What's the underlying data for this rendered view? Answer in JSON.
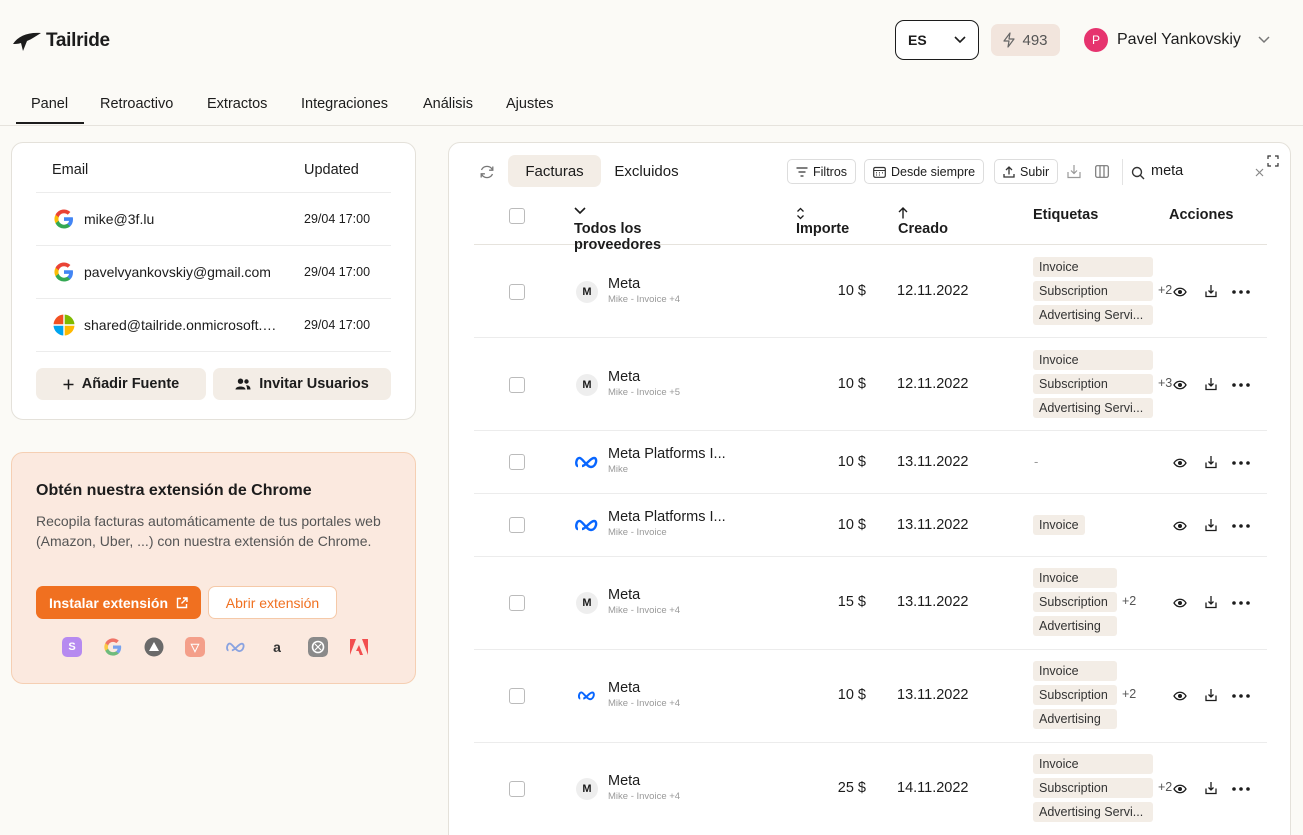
{
  "app": {
    "name": "Tailride"
  },
  "header": {
    "language": "ES",
    "credits": "493",
    "user_initial": "P",
    "user_name": "Pavel Yankovskiy"
  },
  "nav": {
    "tabs": [
      "Panel",
      "Retroactivo",
      "Extractos",
      "Integraciones",
      "Análisis",
      "Ajustes"
    ],
    "active": "Panel"
  },
  "sources": {
    "col_email": "Email",
    "col_updated": "Updated",
    "rows": [
      {
        "provider": "google",
        "email": "mike@3f.lu",
        "updated": "29/04 17:00"
      },
      {
        "provider": "google",
        "email": "pavelvyankovskiy@gmail.com",
        "updated": "29/04 17:00"
      },
      {
        "provider": "microsoft",
        "email": "shared@tailride.onmicrosoft.com",
        "updated": "29/04 17:00"
      }
    ],
    "add_source": "Añadir Fuente",
    "invite_users": "Invitar Usuarios"
  },
  "extension": {
    "title": "Obtén nuestra extensión de Chrome",
    "description": "Recopila facturas automáticamente de tus portales web (Amazon, Uber, ...) con nuestra extensión de Chrome.",
    "install_label": "Instalar extensión",
    "open_label": "Abrir extensión",
    "icons": [
      "stripe-icon",
      "google-icon",
      "arc-icon",
      "shop-icon",
      "meta-icon",
      "amazon-icon",
      "openai-icon",
      "adobe-icon"
    ]
  },
  "invoices": {
    "tabs": [
      "Facturas",
      "Excluidos"
    ],
    "active_tab": "Facturas",
    "toolbar": {
      "filters": "Filtros",
      "range": "Desde siempre",
      "upload": "Subir",
      "search_value": "meta"
    },
    "columns": {
      "vendor": "Todos los proveedores",
      "amount": "Importe",
      "created": "Creado",
      "tags": "Etiquetas",
      "actions": "Acciones"
    },
    "rows": [
      {
        "logo": "M",
        "name": "Meta",
        "sub": "Mike - Invoice +4",
        "amount": "10 $",
        "date": "12.11.2022",
        "tags": [
          "Invoice",
          "Subscription",
          "Advertising Servi..."
        ],
        "more": "+2"
      },
      {
        "logo": "M",
        "name": "Meta",
        "sub": "Mike - Invoice +5",
        "amount": "10 $",
        "date": "12.11.2022",
        "tags": [
          "Invoice",
          "Subscription",
          "Advertising Servi..."
        ],
        "more": "+3"
      },
      {
        "logo": "meta",
        "name": "Meta Platforms I...",
        "sub": "Mike",
        "amount": "10 $",
        "date": "13.11.2022",
        "tags": [],
        "more": "",
        "empty": "-"
      },
      {
        "logo": "meta",
        "name": "Meta Platforms I...",
        "sub": "Mike - Invoice",
        "amount": "10 $",
        "date": "13.11.2022",
        "tags": [
          "Invoice"
        ],
        "more": ""
      },
      {
        "logo": "M",
        "name": "Meta",
        "sub": "Mike - Invoice +4",
        "amount": "15 $",
        "date": "13.11.2022",
        "tags": [
          "Invoice",
          "Subscription",
          "Advertising"
        ],
        "more": "+2"
      },
      {
        "logo": "meta",
        "name": "Meta",
        "sub": "Mike - Invoice +4",
        "amount": "10 $",
        "date": "13.11.2022",
        "tags": [
          "Invoice",
          "Subscription",
          "Advertising"
        ],
        "more": "+2"
      },
      {
        "logo": "M",
        "name": "Meta",
        "sub": "Mike - Invoice +4",
        "amount": "25 $",
        "date": "14.11.2022",
        "tags": [
          "Invoice",
          "Subscription",
          "Advertising Servi..."
        ],
        "more": "+2"
      }
    ]
  },
  "colors": {
    "accent": "#f07020",
    "background": "#fbfaf6",
    "tag_bg": "#f3ede6",
    "avatar": "#e6336e"
  }
}
